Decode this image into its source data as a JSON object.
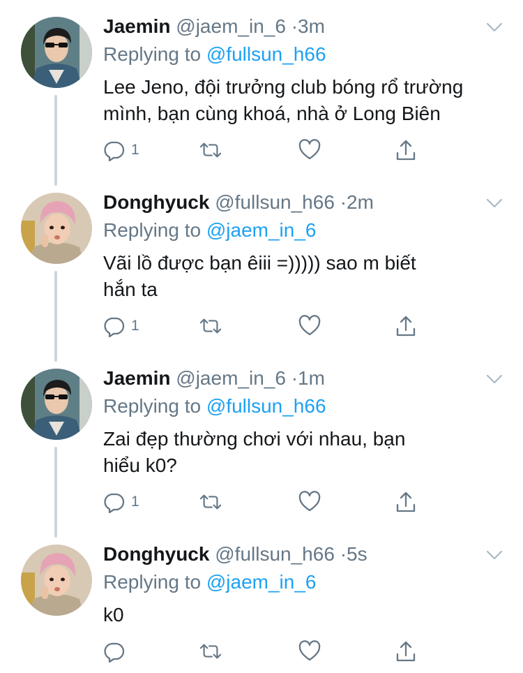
{
  "tweets": [
    {
      "name": "Jaemin",
      "handle": "@jaem_in_6",
      "dot": "·",
      "time": "3m",
      "replying_prefix": "Replying to",
      "replying_to": "@fullsun_h66",
      "text": "Lee Jeno, đội trưởng club bóng rổ trường mình, bạn cùng khoá, nhà ở Long Biên",
      "reply_count": "1",
      "avatar": "jaemin"
    },
    {
      "name": "Donghyuck",
      "handle": "@fullsun_h66",
      "dot": "·",
      "time": "2m",
      "replying_prefix": "Replying to",
      "replying_to": "@jaem_in_6",
      "text": "Vãi lồ được bạn êiii =))))) sao m biết hắn ta",
      "reply_count": "1",
      "avatar": "donghyuck"
    },
    {
      "name": "Jaemin",
      "handle": "@jaem_in_6",
      "dot": "·",
      "time": "1m",
      "replying_prefix": "Replying to",
      "replying_to": "@fullsun_h66",
      "text": "Zai đẹp thường chơi với nhau, bạn hiểu k0?",
      "reply_count": "1",
      "avatar": "jaemin"
    },
    {
      "name": "Donghyuck",
      "handle": "@fullsun_h66",
      "dot": "·",
      "time": "5s",
      "replying_prefix": "Replying to",
      "replying_to": "@jaem_in_6",
      "text": "k0",
      "reply_count": "",
      "avatar": "donghyuck"
    }
  ],
  "icons": {
    "reply": "reply-icon",
    "retweet": "retweet-icon",
    "like": "heart-icon",
    "share": "share-icon",
    "menu": "chevron-down-icon"
  },
  "colors": {
    "link": "#1da1f2",
    "muted": "#657786",
    "thread_line": "#ccd6dd"
  }
}
